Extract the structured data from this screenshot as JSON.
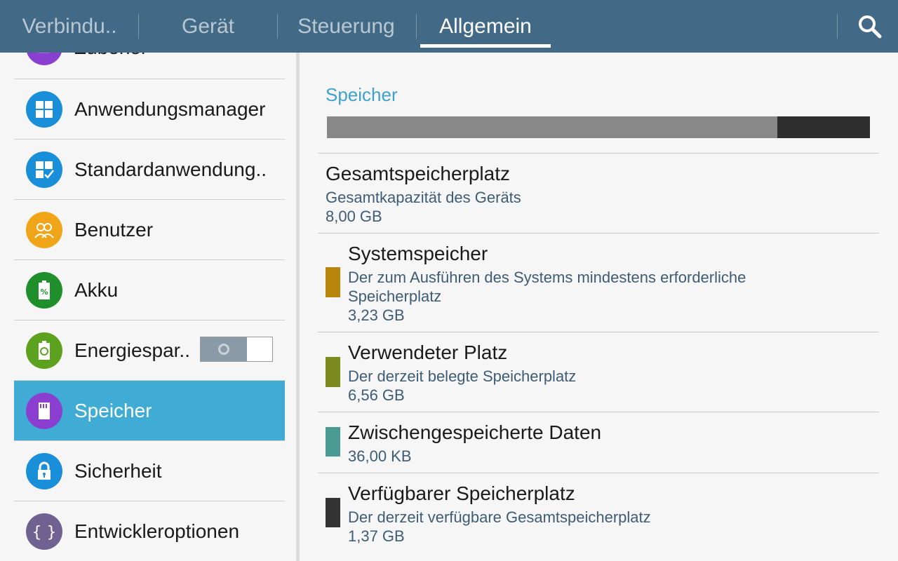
{
  "tabs": [
    {
      "label": "Verbindu.."
    },
    {
      "label": "Gerät"
    },
    {
      "label": "Steuerung"
    },
    {
      "label": "Allgemein"
    }
  ],
  "left_list": {
    "items": [
      {
        "label": "Zubehör",
        "icon": "accessory-icon",
        "color": "#8a3fd1"
      },
      {
        "label": "Anwendungsmanager",
        "icon": "apps-grid-icon",
        "color": "#1a8fd9"
      },
      {
        "label": "Standardanwendung..",
        "icon": "default-apps-icon",
        "color": "#1a8fd9"
      },
      {
        "label": "Benutzer",
        "icon": "users-icon",
        "color": "#f0a418"
      },
      {
        "label": "Akku",
        "icon": "battery-icon",
        "color": "#1f8f2b"
      },
      {
        "label": "Energiespar..",
        "icon": "power-saving-icon",
        "color": "#5da21f",
        "toggle": false
      },
      {
        "label": "Speicher",
        "icon": "storage-icon",
        "color": "#8a3fd1",
        "selected": true
      },
      {
        "label": "Sicherheit",
        "icon": "lock-icon",
        "color": "#1a8fd9"
      },
      {
        "label": "Entwickleroptionen",
        "icon": "developer-braces-icon",
        "color": "#6f6290"
      }
    ]
  },
  "storage": {
    "section_title": "Speicher",
    "used_fraction": 0.83,
    "total": {
      "title": "Gesamtspeicherplatz",
      "subtitle": "Gesamtkapazität des Geräts",
      "value": "8,00 GB"
    },
    "entries": [
      {
        "title": "Systemspeicher",
        "line1": "Der zum Ausführen des Systems mindestens erforderliche",
        "line2": "Speicherplatz",
        "value": "3,23 GB",
        "color": "#b8860b"
      },
      {
        "title": "Verwendeter Platz",
        "line1": "Der derzeit belegte Speicherplatz",
        "value": "6,56 GB",
        "color": "#7a8a1e"
      },
      {
        "title": "Zwischengespeicherte Daten",
        "value": "36,00 KB",
        "color": "#4a9a94"
      },
      {
        "title": "Verfügbarer Speicherplatz",
        "line1": "Der derzeit verfügbare Gesamtspeicherplatz",
        "value": "1,37 GB",
        "color": "#333333"
      }
    ]
  }
}
